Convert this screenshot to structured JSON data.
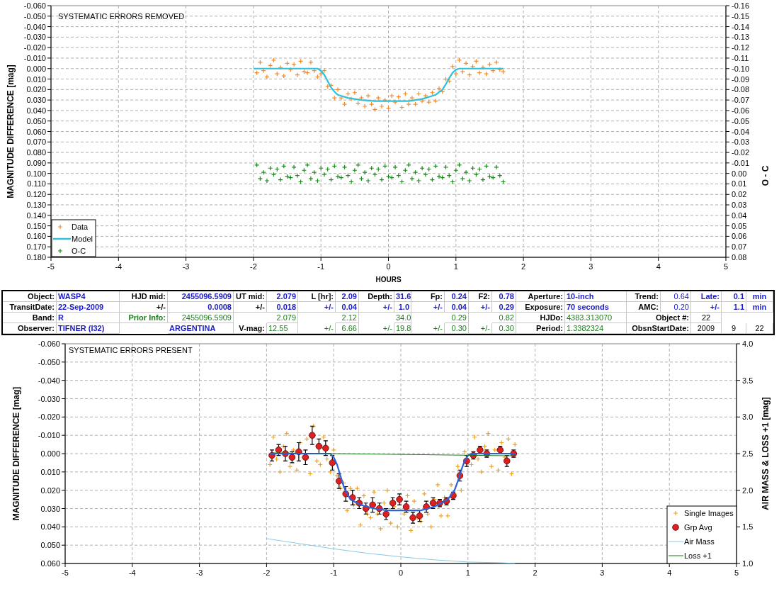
{
  "light_curve_top": {
    "chart_data": {
      "type": "scatter",
      "title": "SYSTEMATIC ERRORS REMOVED",
      "xlabel": "HOURS",
      "ylabel": "MAGNITUDE DIFFERENCE [mag]",
      "y2label": "O - C",
      "xlim": [
        -5,
        5
      ],
      "ylim": [
        0.18,
        -0.06
      ],
      "y2lim": [
        0.08,
        -0.16
      ],
      "grid": true,
      "legend": true,
      "xticks": [
        -5,
        -4,
        -3,
        -2,
        -1,
        0,
        1,
        2,
        3,
        4,
        5
      ],
      "yticks": [
        {
          "value": -0.06,
          "label": "-0.060"
        },
        {
          "value": -0.05,
          "label": "-0.050"
        },
        {
          "value": -0.04,
          "label": "-0.040"
        },
        {
          "value": -0.03,
          "label": "-0.030"
        },
        {
          "value": -0.02,
          "label": "-0.020"
        },
        {
          "value": -0.01,
          "label": "-0.010"
        },
        {
          "value": 0,
          "label": "0.000"
        },
        {
          "value": 0.01,
          "label": "0.010"
        },
        {
          "value": 0.02,
          "label": "0.020"
        },
        {
          "value": 0.03,
          "label": "0.030"
        },
        {
          "value": 0.04,
          "label": "0.040"
        },
        {
          "value": 0.05,
          "label": "0.050"
        },
        {
          "value": 0.06,
          "label": "0.060"
        },
        {
          "value": 0.07,
          "label": "0.070"
        },
        {
          "value": 0.08,
          "label": "0.080"
        },
        {
          "value": 0.09,
          "label": "0.090"
        },
        {
          "value": 0.1,
          "label": "0.100"
        },
        {
          "value": 0.11,
          "label": "0.110"
        },
        {
          "value": 0.12,
          "label": "0.120"
        },
        {
          "value": 0.13,
          "label": "0.130"
        },
        {
          "value": 0.14,
          "label": "0.140"
        },
        {
          "value": 0.15,
          "label": "0.150"
        },
        {
          "value": 0.16,
          "label": "0.160"
        },
        {
          "value": 0.17,
          "label": "0.170"
        },
        {
          "value": 0.18,
          "label": "0.180"
        }
      ],
      "y2ticks": [
        {
          "value": -0.16,
          "label": "-0.16"
        },
        {
          "value": -0.15,
          "label": "-0.15"
        },
        {
          "value": -0.14,
          "label": "-0.14"
        },
        {
          "value": -0.13,
          "label": "-0.13"
        },
        {
          "value": -0.12,
          "label": "-0.12"
        },
        {
          "value": -0.11,
          "label": "-0.11"
        },
        {
          "value": -0.1,
          "label": "-0.10"
        },
        {
          "value": -0.09,
          "label": "-0.09"
        },
        {
          "value": -0.08,
          "label": "-0.08"
        },
        {
          "value": -0.07,
          "label": "-0.07"
        },
        {
          "value": -0.06,
          "label": "-0.06"
        },
        {
          "value": -0.05,
          "label": "-0.05"
        },
        {
          "value": -0.04,
          "label": "-0.04"
        },
        {
          "value": -0.03,
          "label": "-0.03"
        },
        {
          "value": -0.02,
          "label": "-0.02"
        },
        {
          "value": -0.01,
          "label": "-0.01"
        },
        {
          "value": 0,
          "label": "0.00"
        },
        {
          "value": 0.01,
          "label": "0.01"
        },
        {
          "value": 0.02,
          "label": "0.02"
        },
        {
          "value": 0.03,
          "label": "0.03"
        },
        {
          "value": 0.04,
          "label": "0.04"
        },
        {
          "value": 0.05,
          "label": "0.05"
        },
        {
          "value": 0.06,
          "label": "0.06"
        },
        {
          "value": 0.07,
          "label": "0.07"
        },
        {
          "value": 0.08,
          "label": "0.08"
        }
      ],
      "x": [
        -1.95,
        -1.9,
        -1.85,
        -1.8,
        -1.75,
        -1.7,
        -1.65,
        -1.6,
        -1.55,
        -1.5,
        -1.45,
        -1.4,
        -1.35,
        -1.3,
        -1.25,
        -1.2,
        -1.15,
        -1.1,
        -1.05,
        -1.0,
        -0.95,
        -0.9,
        -0.85,
        -0.8,
        -0.75,
        -0.7,
        -0.65,
        -0.6,
        -0.55,
        -0.5,
        -0.45,
        -0.4,
        -0.35,
        -0.3,
        -0.25,
        -0.2,
        -0.15,
        -0.1,
        -0.05,
        0,
        0.05,
        0.1,
        0.15,
        0.2,
        0.25,
        0.3,
        0.35,
        0.4,
        0.45,
        0.5,
        0.55,
        0.6,
        0.65,
        0.7,
        0.75,
        0.8,
        0.85,
        0.9,
        0.95,
        1.0,
        1.05,
        1.1,
        1.15,
        1.2,
        1.25,
        1.3,
        1.35,
        1.4,
        1.45,
        1.5,
        1.55,
        1.6,
        1.65,
        1.7
      ],
      "series": [
        {
          "name": "Data",
          "type": "scatter",
          "color": "#f08a30",
          "values": [
            0.004,
            -0.006,
            0.002,
            0.008,
            -0.003,
            -0.008,
            0.005,
            -0.001,
            0.007,
            -0.005,
            0.001,
            -0.004,
            0.006,
            -0.007,
            0.003,
            0.004,
            -0.006,
            0.002,
            0.008,
            0.005,
            0.002,
            0.017,
            0.016,
            0.028,
            0.02,
            0.028,
            0.034,
            0.024,
            0.029,
            0.023,
            0.033,
            0.028,
            0.036,
            0.026,
            0.034,
            0.039,
            0.028,
            0.036,
            0.03,
            0.038,
            0.026,
            0.032,
            0.027,
            0.037,
            0.024,
            0.034,
            0.028,
            0.034,
            0.024,
            0.031,
            0.026,
            0.032,
            0.023,
            0.031,
            0.019,
            0.022,
            0.01,
            0.012,
            -0.002,
            0.005,
            -0.008,
            0.003,
            -0.005,
            0.006,
            -0.002,
            -0.007,
            0.004,
            -0.001,
            0.005,
            -0.004,
            0.002,
            -0.006,
            0.001,
            0.003
          ]
        },
        {
          "name": "Model",
          "type": "line",
          "color": "#30c0d8",
          "x": [
            -2,
            -1.05,
            -1.0,
            -0.95,
            -0.9,
            -0.85,
            -0.8,
            -0.75,
            -0.7,
            -0.6,
            -0.4,
            -0.2,
            0,
            0.2,
            0.3,
            0.4,
            0.5,
            0.6,
            0.7,
            0.8,
            0.85,
            0.9,
            0.95,
            1.0,
            1.05,
            1.7
          ],
          "values": [
            0,
            0,
            0.002,
            0.006,
            0.012,
            0.018,
            0.022,
            0.025,
            0.026,
            0.028,
            0.03,
            0.031,
            0.031,
            0.031,
            0.031,
            0.03,
            0.029,
            0.027,
            0.025,
            0.02,
            0.015,
            0.009,
            0.004,
            0.001,
            0,
            0
          ]
        },
        {
          "name": "O-C",
          "type": "scatter",
          "color": "#1a8a1a",
          "axis": "y2",
          "values": [
            -0.008,
            0.005,
            -0.001,
            0.007,
            -0.005,
            0.001,
            -0.004,
            0.006,
            -0.007,
            0.003,
            0.004,
            -0.006,
            0.002,
            0.008,
            -0.003,
            -0.008,
            0.005,
            -0.001,
            0.007,
            -0.005,
            0.001,
            -0.004,
            0.006,
            -0.007,
            0.003,
            0.004,
            -0.006,
            0.002,
            0.008,
            -0.003,
            -0.008,
            0.005,
            -0.001,
            0.007,
            -0.005,
            0.001,
            -0.004,
            0.006,
            -0.007,
            0.003,
            0.004,
            -0.006,
            0.002,
            0.008,
            -0.003,
            -0.008,
            0.005,
            -0.001,
            0.007,
            -0.005,
            0.001,
            -0.004,
            0.006,
            -0.007,
            0.003,
            0.004,
            -0.006,
            0.002,
            0.008,
            -0.003,
            -0.008,
            0.005,
            -0.001,
            0.007,
            -0.005,
            0.001,
            -0.004,
            0.006,
            -0.007,
            0.003,
            0.004,
            -0.006,
            0.002,
            0.008
          ]
        }
      ]
    }
  },
  "parameters": {
    "rows": [
      {
        "cells": [
          {
            "text": "Object:",
            "kind": "label"
          },
          {
            "text": "WASP4",
            "kind": "name"
          },
          {
            "text": "HJD mid:",
            "kind": "label"
          },
          {
            "text": "2455096.5909",
            "kind": "value"
          },
          {
            "text": "UT mid:",
            "kind": "label"
          },
          {
            "text": "2.079",
            "kind": "value"
          },
          {
            "text": "L [hr]:",
            "kind": "label"
          },
          {
            "text": "2.09",
            "kind": "value"
          },
          {
            "text": "Depth:",
            "kind": "label"
          },
          {
            "text": "31.6",
            "kind": "value"
          },
          {
            "text": "Fp:",
            "kind": "label"
          },
          {
            "text": "0.24",
            "kind": "value"
          },
          {
            "text": "F2:",
            "kind": "label"
          },
          {
            "text": "0.78",
            "kind": "value"
          },
          {
            "text": "Aperture:",
            "kind": "label"
          },
          {
            "text": "10-inch",
            "kind": "name"
          },
          {
            "text": "Trend:",
            "kind": "label"
          },
          {
            "text": "0.64",
            "kind": "number"
          },
          {
            "text": "Late:",
            "kind": "value"
          },
          {
            "text": "0.1",
            "kind": "value"
          },
          {
            "text": "min",
            "kind": "unit"
          }
        ]
      },
      {
        "cells": [
          {
            "text": "TransitDate:",
            "kind": "label"
          },
          {
            "text": "22-Sep-2009",
            "kind": "name"
          },
          {
            "text": "+/-",
            "kind": "label"
          },
          {
            "text": "0.0008",
            "kind": "value"
          },
          {
            "text": "+/-",
            "kind": "label"
          },
          {
            "text": "0.018",
            "kind": "value"
          },
          {
            "text": "+/-",
            "kind": "value"
          },
          {
            "text": "0.04",
            "kind": "value"
          },
          {
            "text": "+/-",
            "kind": "value"
          },
          {
            "text": "1.0",
            "kind": "value"
          },
          {
            "text": "+/-",
            "kind": "value"
          },
          {
            "text": "0.04",
            "kind": "value"
          },
          {
            "text": "+/-",
            "kind": "value"
          },
          {
            "text": "0.29",
            "kind": "value"
          },
          {
            "text": "Exposure:",
            "kind": "label"
          },
          {
            "text": "70 seconds",
            "kind": "name"
          },
          {
            "text": "AMC:",
            "kind": "label"
          },
          {
            "text": "0.20",
            "kind": "number"
          },
          {
            "text": "+/-",
            "kind": "value"
          },
          {
            "text": "1.1",
            "kind": "value"
          },
          {
            "text": "min",
            "kind": "unit"
          }
        ]
      },
      {
        "cells": [
          {
            "text": "Band:",
            "kind": "label"
          },
          {
            "text": "R",
            "kind": "name"
          },
          {
            "text": "Prior Info:",
            "kind": "prior-label"
          },
          {
            "text": "2455096.5909",
            "kind": "prior"
          },
          {
            "text": ""
          },
          {
            "text": "2.079",
            "kind": "prior"
          },
          {
            "text": ""
          },
          {
            "text": "2.12",
            "kind": "prior"
          },
          {
            "text": ""
          },
          {
            "text": "34.0",
            "kind": "prior"
          },
          {
            "text": ""
          },
          {
            "text": "0.29",
            "kind": "prior"
          },
          {
            "text": ""
          },
          {
            "text": "0.82",
            "kind": "prior"
          },
          {
            "text": "HJDo:",
            "kind": "label"
          },
          {
            "text": "4383.313070",
            "kind": "prior-name"
          },
          {
            "text": ""
          },
          {
            "text": "Object #:",
            "kind": "label"
          },
          {
            "text": "22",
            "kind": "plain"
          },
          {
            "text": ""
          },
          {
            "text": ""
          }
        ]
      },
      {
        "cells": [
          {
            "text": "Observer:",
            "kind": "label"
          },
          {
            "text": "TIFNER (I32)",
            "kind": "name"
          },
          {
            "text": ""
          },
          {
            "text": "ARGENTINA",
            "kind": "name"
          },
          {
            "text": "V-mag:",
            "kind": "label"
          },
          {
            "text": "12.55",
            "kind": "prior-name"
          },
          {
            "text": "+/-",
            "kind": "prior"
          },
          {
            "text": "6.66",
            "kind": "prior"
          },
          {
            "text": "+/-",
            "kind": "prior"
          },
          {
            "text": "19.8",
            "kind": "prior"
          },
          {
            "text": "+/-",
            "kind": "prior"
          },
          {
            "text": "0.30",
            "kind": "prior"
          },
          {
            "text": "+/-",
            "kind": "prior"
          },
          {
            "text": "0.30",
            "kind": "prior"
          },
          {
            "text": "Period:",
            "kind": "label"
          },
          {
            "text": "1.3382324",
            "kind": "prior-name"
          },
          {
            "text": ""
          },
          {
            "text": "ObsnStartDate:",
            "kind": "label"
          },
          {
            "text": "2009",
            "kind": "plain"
          },
          {
            "text": "9",
            "kind": "plain"
          },
          {
            "text": "22",
            "kind": "plain"
          }
        ]
      }
    ]
  },
  "light_curve_bottom": {
    "chart_data": {
      "type": "scatter",
      "title": "SYSTEMATIC ERRORS PRESENT",
      "ylabel": "MAGNITUDE DIFFERENCE [mag]",
      "y2label": "AIR MASS & LOSS +1 [mag]",
      "xlim": [
        -5,
        5
      ],
      "ylim": [
        0.06,
        -0.06
      ],
      "y2lim": [
        1.0,
        4.0
      ],
      "grid": true,
      "legend": true,
      "xticks": [
        -5,
        -4,
        -3,
        -2,
        -1,
        0,
        1,
        2,
        3,
        4,
        5
      ],
      "yticks": [
        {
          "value": -0.06,
          "label": "-0.060"
        },
        {
          "value": -0.05,
          "label": "-0.050"
        },
        {
          "value": -0.04,
          "label": "-0.040"
        },
        {
          "value": -0.03,
          "label": "-0.030"
        },
        {
          "value": -0.02,
          "label": "-0.020"
        },
        {
          "value": -0.01,
          "label": "-0.010"
        },
        {
          "value": 0,
          "label": "0.000"
        },
        {
          "value": 0.01,
          "label": "0.010"
        },
        {
          "value": 0.02,
          "label": "0.020"
        },
        {
          "value": 0.03,
          "label": "0.030"
        },
        {
          "value": 0.04,
          "label": "0.040"
        },
        {
          "value": 0.05,
          "label": "0.050"
        },
        {
          "value": 0.06,
          "label": "0.060"
        }
      ],
      "y2ticks": [
        {
          "value": 1.0,
          "label": "1.0"
        },
        {
          "value": 1.5,
          "label": "1.5"
        },
        {
          "value": 2.0,
          "label": "2.0"
        },
        {
          "value": 2.5,
          "label": "2.5"
        },
        {
          "value": 3.0,
          "label": "3.0"
        },
        {
          "value": 3.5,
          "label": "3.5"
        },
        {
          "value": 4.0,
          "label": "4.0"
        }
      ],
      "x": [
        -1.95,
        -1.9,
        -1.85,
        -1.8,
        -1.75,
        -1.7,
        -1.65,
        -1.6,
        -1.55,
        -1.5,
        -1.45,
        -1.4,
        -1.35,
        -1.3,
        -1.25,
        -1.2,
        -1.15,
        -1.1,
        -1.05,
        -1.0,
        -0.95,
        -0.9,
        -0.85,
        -0.8,
        -0.75,
        -0.7,
        -0.65,
        -0.6,
        -0.55,
        -0.5,
        -0.45,
        -0.4,
        -0.35,
        -0.3,
        -0.25,
        -0.2,
        -0.15,
        -0.1,
        -0.05,
        0,
        0.05,
        0.1,
        0.15,
        0.2,
        0.25,
        0.3,
        0.35,
        0.4,
        0.45,
        0.5,
        0.55,
        0.6,
        0.65,
        0.7,
        0.75,
        0.8,
        0.85,
        0.9,
        0.95,
        1.0,
        1.05,
        1.1,
        1.15,
        1.2,
        1.25,
        1.3,
        1.35,
        1.4,
        1.45,
        1.5,
        1.55,
        1.6,
        1.65,
        1.7
      ],
      "series": [
        {
          "name": "Single Images",
          "type": "scatter",
          "color": "#f0a020",
          "values": [
            0.006,
            -0.009,
            0.003,
            0.01,
            -0.004,
            -0.011,
            0.007,
            -0.002,
            0.009,
            -0.006,
            0.002,
            -0.008,
            0.011,
            -0.015,
            0.004,
            0.006,
            -0.009,
            0.003,
            0.01,
            -0.002,
            0.012,
            0.019,
            0.016,
            0.031,
            0.019,
            0.028,
            0.019,
            0.039,
            0.023,
            0.033,
            0.035,
            0.021,
            0.033,
            0.041,
            0.027,
            0.02,
            0.038,
            0.029,
            0.04,
            0.025,
            0.033,
            0.023,
            0.042,
            0.026,
            0.035,
            0.037,
            0.022,
            0.033,
            0.04,
            0.025,
            0.017,
            0.034,
            0.024,
            0.034,
            0.017,
            0.022,
            0.007,
            0.02,
            -0.001,
            0.005,
            0.006,
            -0.009,
            0.003,
            0.01,
            -0.004,
            -0.011,
            0.007,
            -0.002,
            0.009,
            -0.006,
            0.002,
            -0.008,
            0.011,
            -0.005
          ]
        },
        {
          "name": "Grp Avg",
          "type": "scatter",
          "color": "#e02020",
          "x": [
            -1.92,
            -1.82,
            -1.72,
            -1.62,
            -1.52,
            -1.42,
            -1.32,
            -1.22,
            -1.12,
            -1.02,
            -0.92,
            -0.82,
            -0.72,
            -0.62,
            -0.52,
            -0.42,
            -0.32,
            -0.22,
            -0.12,
            -0.02,
            0.08,
            0.18,
            0.28,
            0.38,
            0.48,
            0.58,
            0.68,
            0.78,
            0.88,
            0.98,
            1.08,
            1.18,
            1.28,
            1.48,
            1.58,
            1.68
          ],
          "values": [
            0.001,
            -0.002,
            0.0,
            0.002,
            -0.001,
            0.002,
            -0.01,
            -0.004,
            -0.003,
            0.005,
            0.015,
            0.022,
            0.024,
            0.027,
            0.03,
            0.028,
            0.03,
            0.033,
            0.027,
            0.025,
            0.029,
            0.035,
            0.034,
            0.029,
            0.027,
            0.027,
            0.026,
            0.023,
            0.012,
            0.004,
            0.001,
            -0.002,
            0.0,
            -0.002,
            0.004,
            0.0
          ],
          "errors": [
            0.003,
            0.003,
            0.004,
            0.003,
            0.005,
            0.004,
            0.005,
            0.004,
            0.004,
            0.004,
            0.004,
            0.004,
            0.004,
            0.003,
            0.003,
            0.004,
            0.003,
            0.003,
            0.003,
            0.003,
            0.003,
            0.003,
            0.003,
            0.003,
            0.003,
            0.002,
            0.002,
            0.002,
            0.003,
            0.003,
            0.002,
            0.002,
            0.002,
            0.002,
            0.003,
            0.002
          ]
        },
        {
          "type": "line",
          "color": "#3060d8",
          "x": [
            -1.95,
            -1.05,
            -1.0,
            -0.95,
            -0.9,
            -0.85,
            -0.8,
            -0.75,
            -0.7,
            -0.6,
            -0.4,
            -0.2,
            0,
            0.2,
            0.3,
            0.4,
            0.5,
            0.6,
            0.7,
            0.8,
            0.85,
            0.9,
            0.95,
            1.0,
            1.05,
            1.7
          ],
          "values": [
            0,
            0,
            0.002,
            0.006,
            0.012,
            0.018,
            0.022,
            0.025,
            0.026,
            0.028,
            0.03,
            0.031,
            0.031,
            0.031,
            0.031,
            0.03,
            0.029,
            0.027,
            0.025,
            0.02,
            0.015,
            0.009,
            0.004,
            0.001,
            0,
            0
          ]
        },
        {
          "name": "Air Mass",
          "type": "line",
          "color": "#88c8e8",
          "axis": "y2",
          "x": [
            -2,
            -1.5,
            -1,
            -0.5,
            0,
            0.5,
            1,
            1.5,
            1.7
          ],
          "values": [
            1.34,
            1.27,
            1.2,
            1.14,
            1.09,
            1.05,
            1.02,
            1.01,
            1.0
          ]
        },
        {
          "name": "Loss +1",
          "type": "line",
          "color": "#1a7a1a",
          "axis": "y2",
          "x": [
            -1.9,
            1.7
          ],
          "values": [
            2.51,
            2.47
          ]
        }
      ]
    }
  }
}
